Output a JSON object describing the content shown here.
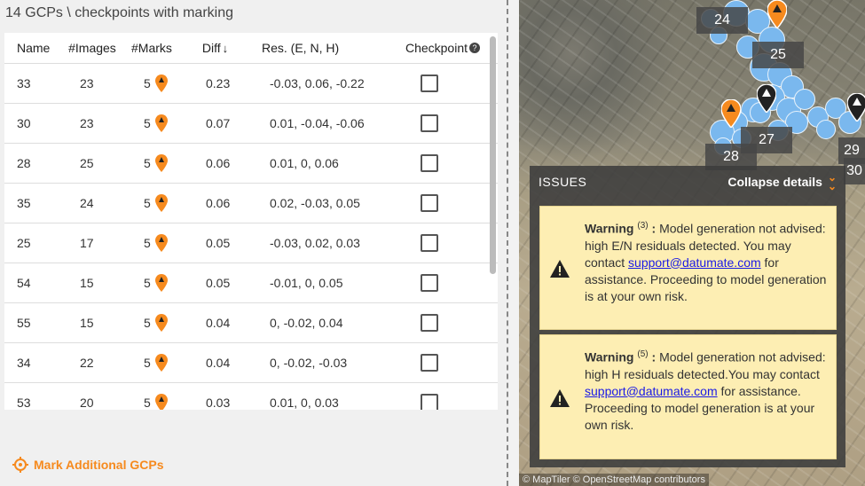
{
  "panel": {
    "title": "14 GCPs \\ checkpoints with marking"
  },
  "table": {
    "headers": {
      "name": "Name",
      "images": "#Images",
      "marks": "#Marks",
      "diff": "Diff",
      "res": "Res. (E, N, H)",
      "checkpoint": "Checkpoint"
    },
    "rows": [
      {
        "name": "33",
        "images": "23",
        "marks": "5",
        "diff": "0.23",
        "res": "-0.03, 0.06, -0.22"
      },
      {
        "name": "30",
        "images": "23",
        "marks": "5",
        "diff": "0.07",
        "res": "0.01, -0.04, -0.06"
      },
      {
        "name": "28",
        "images": "25",
        "marks": "5",
        "diff": "0.06",
        "res": "0.01, 0, 0.06"
      },
      {
        "name": "35",
        "images": "24",
        "marks": "5",
        "diff": "0.06",
        "res": "0.02, -0.03, 0.05"
      },
      {
        "name": "25",
        "images": "17",
        "marks": "5",
        "diff": "0.05",
        "res": "-0.03, 0.02, 0.03"
      },
      {
        "name": "54",
        "images": "15",
        "marks": "5",
        "diff": "0.05",
        "res": "-0.01, 0, 0.05"
      },
      {
        "name": "55",
        "images": "15",
        "marks": "5",
        "diff": "0.04",
        "res": "0, -0.02, 0.04"
      },
      {
        "name": "34",
        "images": "22",
        "marks": "5",
        "diff": "0.04",
        "res": "0, -0.02, -0.03"
      },
      {
        "name": "53",
        "images": "20",
        "marks": "5",
        "diff": "0.03",
        "res": "0.01, 0, 0.03"
      }
    ]
  },
  "mark_button": {
    "label": "Mark Additional GCPs"
  },
  "map": {
    "labels": [
      "24",
      "25",
      "27",
      "28",
      "29",
      "30"
    ],
    "attribution": "© MapTiler © OpenStreetMap contributors"
  },
  "issues": {
    "title": "ISSUES",
    "collapse_label": "Collapse details",
    "warnings": [
      {
        "label": "Warning",
        "count": "(3)",
        "text_before": "Model generation not advised: high E/N residuals detected. You may contact",
        "email": "support@datumate.com",
        "text_after": "for assistance. Proceeding to model generation is at your own risk."
      },
      {
        "label": "Warning",
        "count": "(5)",
        "text_before": "Model generation not advised: high H residuals detected.You may contact",
        "email": "support@datumate.com",
        "text_after": "for assistance. Proceeding to model generation is at your own risk."
      }
    ]
  },
  "colors": {
    "accent": "#f68a1e",
    "warning_bg": "#fdeeb3",
    "point_blue": "#7ab8ee"
  },
  "icons": {
    "sort": "arrow-down-icon",
    "help": "help-circle-icon",
    "pin": "map-pin-icon",
    "warning": "warning-triangle-icon",
    "target": "crosshair-icon",
    "collapse": "chevron-double-down-icon"
  }
}
